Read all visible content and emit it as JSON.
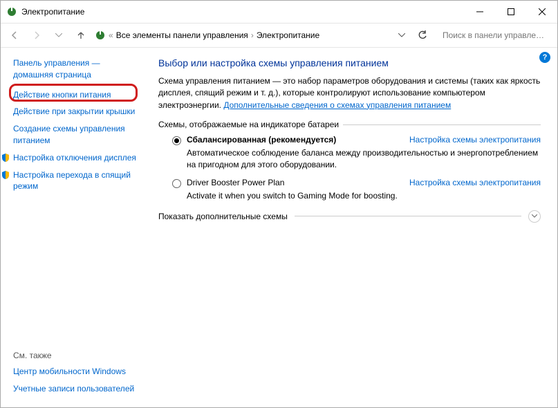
{
  "window": {
    "title": "Электропитание"
  },
  "toolbar": {
    "breadcrumb_prefix": "«",
    "breadcrumb1": "Все элементы панели управления",
    "breadcrumb2": "Электропитание",
    "search_placeholder": "Поиск в панели управлен..."
  },
  "sidebar": {
    "home": "Панель управления — домашняя страница",
    "link1": "Действие кнопки питания",
    "link2": "Действие при закрытии крышки",
    "link3": "Создание схемы управления питанием",
    "link4": "Настройка отключения дисплея",
    "link5": "Настройка перехода в спящий режим",
    "seealso_hdr": "См. также",
    "seealso1": "Центр мобильности Windows",
    "seealso2": "Учетные записи пользователей"
  },
  "main": {
    "heading": "Выбор или настройка схемы управления питанием",
    "desc_text": "Схема управления питанием — это набор параметров оборудования и системы (таких как яркость дисплея, спящий режим и т. д.), которые контролируют использование компьютером электроэнергии. ",
    "desc_link": "Дополнительные сведения о схемах управления питанием",
    "group_label": "Схемы, отображаемые на индикаторе батареи",
    "plan1_name": "Сбалансированная (рекомендуется)",
    "plan1_link": "Настройка схемы электропитания",
    "plan1_desc": "Автоматическое соблюдение баланса между производительностью и энергопотреблением на пригодном для этого оборудовании.",
    "plan2_name": "Driver Booster Power Plan",
    "plan2_link": "Настройка схемы электропитания",
    "plan2_desc": "Activate it when you switch to Gaming Mode for boosting.",
    "showmore": "Показать дополнительные схемы"
  }
}
